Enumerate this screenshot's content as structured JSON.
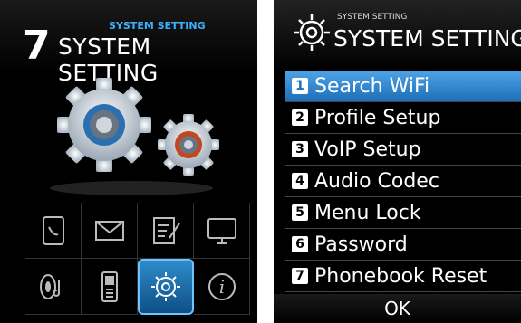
{
  "left": {
    "header_number": "7",
    "header_small": "SYSTEM SETTING",
    "header_title": "SYSTEM SETTING",
    "grid_icons": [
      "phonebook-icon",
      "message-icon",
      "memo-icon",
      "display-icon",
      "sound-icon",
      "phone-icon",
      "settings-icon",
      "info-icon"
    ],
    "selected_icon": "settings-icon"
  },
  "right": {
    "header_small": "SYSTEM SETTING",
    "header_title": "SYSTEM SETTING",
    "menu": [
      {
        "num": "1",
        "label": "Search WiFi",
        "active": true
      },
      {
        "num": "2",
        "label": "Profile Setup",
        "active": false
      },
      {
        "num": "3",
        "label": "VoIP Setup",
        "active": false
      },
      {
        "num": "4",
        "label": "Audio Codec",
        "active": false
      },
      {
        "num": "5",
        "label": "Menu Lock",
        "active": false
      },
      {
        "num": "6",
        "label": "Password",
        "active": false
      },
      {
        "num": "7",
        "label": "Phonebook Reset",
        "active": false
      }
    ],
    "ok_label": "OK"
  },
  "colors": {
    "accent": "#1c6fb8",
    "highlight": "#3ab3ff"
  }
}
